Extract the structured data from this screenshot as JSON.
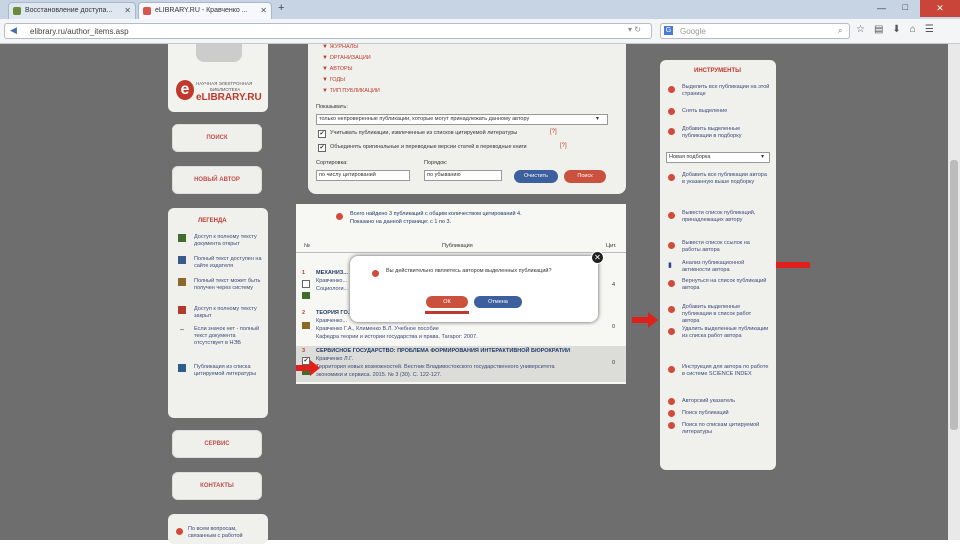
{
  "browser": {
    "tabs": [
      {
        "label": "Восстановление доступа..."
      },
      {
        "label": "eLIBRARY.RU - Кравченко ..."
      }
    ],
    "new_tab": "+",
    "url": "elibrary.ru/author_items.asp",
    "search_placeholder": "Google",
    "window_close": "✕"
  },
  "logo": {
    "line1": "НАУЧНАЯ ЭЛЕКТРОННАЯ",
    "line2": "БИБЛИОТЕКА",
    "brand": "eLIBRARY.RU"
  },
  "left_sidebar": {
    "search_button": "ПОИСК",
    "author_button": "НОВЫЙ АВТОР",
    "legend_title": "ЛЕГЕНДА",
    "legend_items": [
      "Доступ к полному тексту документа открыт",
      "Полный текст доступен на сайте издателя",
      "Полный текст может быть получен через систему",
      "Доступ к полному тексту закрыт",
      "Если значок нет - полный текст документа отсутствует в НЭБ",
      "Публикация из списка цитируемой литературы"
    ],
    "help_button": "СЕРВИС",
    "contacts_button": "КОНТАКТЫ",
    "bottom_note": "По всем вопросам, связанным с работой"
  },
  "filters": {
    "menu_items": [
      "ЖУРНАЛЫ",
      "ОРГАНИЗАЦИИ",
      "АВТОРЫ",
      "ГОДЫ",
      "ТИП ПУБЛИКАЦИИ"
    ],
    "show_label": "Показывать:",
    "show_value": "только непроверенные публикации, которые могут принадлежать данному автору",
    "check1": "Учитывать публикации, извлеченные из списков цитируемой литературы",
    "check2": "Объединять оригинальные и переводные версии статей в переводные книги",
    "sort_label": "Сортировка:",
    "sort_value": "по числу цитирований",
    "order_label": "Порядок:",
    "order_value": "по убыванию",
    "apply_button": "Очистить",
    "search_button": "Поиск"
  },
  "results": {
    "summary1": "Всего найдено 3 публикаций с общим количеством цитирований 4.",
    "summary2": "Показано на данной странице: с 1 по 3.",
    "col_num": "№",
    "col_pub": "Публикация",
    "col_cit": "Цит.",
    "rows": [
      {
        "num": "1",
        "title": "МЕХАНИЗ...",
        "authors": "Кравченко...",
        "source": "Социологи...",
        "cit": "4"
      },
      {
        "num": "2",
        "title": "ТЕОРИЯ ГО...",
        "authors": "Кравченко...",
        "source": "Кравченко Г.А., Клименко В.Л. Учебное пособие",
        "extra1": "Кафедра теории и истории государства и права. Тагарог: 2007.",
        "extra2": "",
        "cit": "0"
      },
      {
        "num": "3",
        "title": "СЕРВИСНОЕ ГОСУДАРСТВО: ПРОБЛЕМА ФОРМИРОВАНИЯ ИНТЕРАКТИВНОЙ БЮРОКРАТИИ",
        "authors": "Кравченко Л.Г.",
        "source": "Территория новых возможностей. Вестник Владивостокского государственного университета",
        "extra1": "экономики и сервиса. 2015. № 3 (30). С. 122-127.",
        "cit": "0"
      }
    ]
  },
  "dialog": {
    "message": "Вы действительно являетесь автором выделенных публикаций?",
    "ok": "ОК",
    "cancel": "Отмена"
  },
  "tools": {
    "title": "ИНСТРУМЕНТЫ",
    "items": [
      "Выделить все публикации на этой странице",
      "Снять выделение",
      "Добавить выделенные публикации в подборку",
      "Добавить все публикации автора в указанную выше подборку",
      "Вывести список публикаций, принадлежащих автору",
      "Вывести список ссылок на работы автора",
      "Анализ публикационной активности автора",
      "Вернуться на список публикаций автора",
      "Добавить выделенные публикации в список работ автора",
      "Удалить выделенные публикации из списка работ автора",
      "Инструкция для автора по работе в системе SCIENCE INDEX",
      "Авторский указатель",
      "Поиск публикаций",
      "Поиск по спискам цитируемой литературы"
    ],
    "select_value": "Новая подборка"
  }
}
